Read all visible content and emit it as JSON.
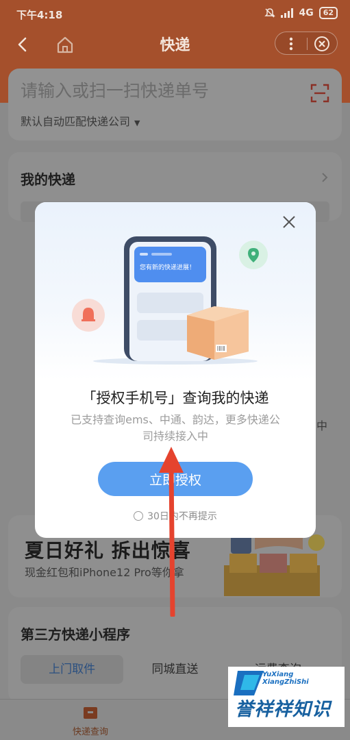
{
  "status_bar": {
    "time": "下午4:18",
    "network": "4G",
    "battery": "62"
  },
  "nav": {
    "title": "快递"
  },
  "search": {
    "placeholder": "请输入或扫一扫快递单号",
    "company": "默认自动匹配快递公司"
  },
  "my_express": {
    "title": "我的快递",
    "side_text": "中"
  },
  "modal": {
    "bubble_text": "您有新的快递进展！",
    "title": "「授权手机号」查询我的快递",
    "desc_line1": "已支持查询ems、中通、韵达，更多快递公",
    "desc_line2": "司持续接入中",
    "button": "立即授权",
    "no_remind": "30日内不再提示"
  },
  "promo": {
    "title": "夏日好礼 拆出惊喜",
    "subtitle": "现金红包和iPhone12 Pro等你拿"
  },
  "mini_programs": {
    "title": "第三方快递小程序",
    "tabs": [
      "上门取件",
      "同城直送",
      "运费查询"
    ]
  },
  "bottom_nav": {
    "item_label": "快递查询"
  },
  "watermark": {
    "line1": "YuXiang",
    "line2": "XiangZhiShi",
    "brand": "誉祥祥知识"
  },
  "colors": {
    "nav_bg": "#a5502c",
    "primary_button": "#5a9ff0",
    "arrow": "#e5432e"
  }
}
